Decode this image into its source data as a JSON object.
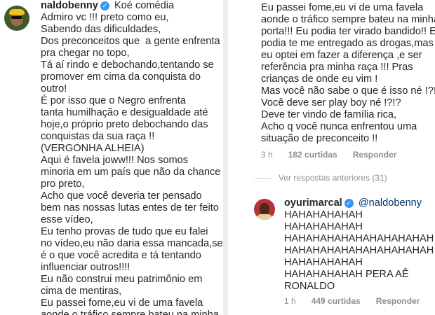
{
  "left_comment": {
    "username": "naldobenny",
    "first_line_text": "Koé comédia",
    "lines": [
      "Admiro vc !!! preto como eu,",
      "Sabendo das dificuldades,",
      "Dos preconceitos que  a gente enfrenta",
      "pra chegar no topo,",
      "Tá aí rindo e debochando,tentando se",
      "promover em cima da conquista do",
      "outro!",
      "É por isso que o Negro enfrenta",
      "tanta humilhação e desigualdade até",
      "hoje,o próprio preto debochando das",
      "conquistas da sua raça !!",
      "(VERGONHA ALHEIA)",
      "Aqui é favela joww!!! Nos somos",
      "minoria em um país que não da chance",
      "pro preto,",
      "Acho que você deveria ter pensado",
      "bem nas nossas lutas entes de ter feito",
      "esse vídeo,",
      "Eu tenho provas de tudo que eu falei",
      "no vídeo,eu não daria essa mancada,se",
      "é o que você acredita e tá tentando",
      "influenciar outros!!!!",
      "Eu não construi meu patrimônio em",
      "cima de mentiras,",
      "Eu passei fome,eu vi de uma favela",
      "aonde o tráfico sempre bateu na minha"
    ]
  },
  "right_comment": {
    "lines": [
      "Eu passei fome,eu vi de uma favela",
      "aonde o tráfico sempre bateu na minha",
      "porta!!! Eu podia ter virado bandido!! Eu",
      "podia te me entregado as drogas,mas",
      "eu optei em fazer a diferença ,e ser",
      "referência pra minha raça !!! Pras",
      "crianças de onde eu vim !",
      "Mas você não sabe o que é isso né !?!?",
      "Você deve ser play boy né !?!?",
      "Deve ter vindo de família rica,",
      "Acho q você nunca enfrentou uma",
      "situação de preconceito !!"
    ],
    "time": "3 h",
    "likes": "182 curtidas",
    "reply_label": "Responder"
  },
  "view_previous": "Ver respostas anteriores (31)",
  "reply": {
    "username": "oyurimarcal",
    "mention": "@naldobenny",
    "lines": [
      "HAHAHAHAHAH",
      "HAHAHAHAHAH",
      "HAHAHAHAHAHAHAHAHAHAH",
      "HAHAHAHAHAHAHAHAHAHAH",
      "HAHAHAHAHAH",
      "HAHAHAHAHAH PERA AÊ",
      "RONALDO"
    ],
    "time": "1 h",
    "likes": "449 curtidas",
    "reply_label": "Responder"
  },
  "colors": {
    "verified": "#3897f0",
    "mention": "#00376b",
    "meta": "#8e8e8e"
  }
}
